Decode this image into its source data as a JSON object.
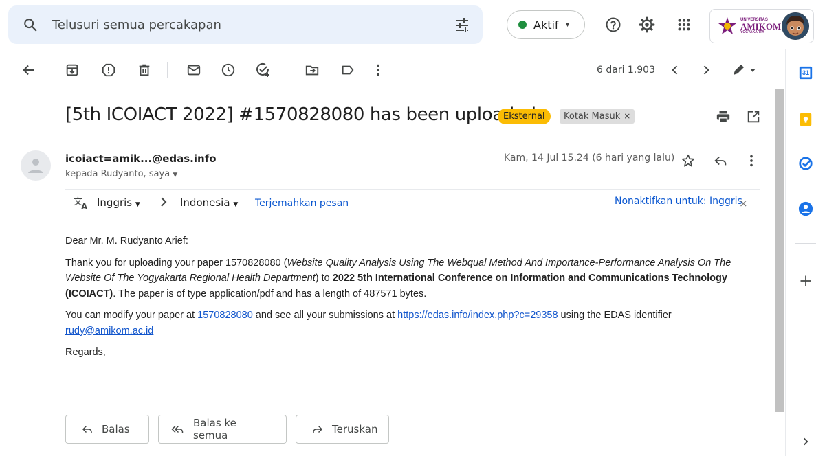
{
  "search": {
    "placeholder": "Telusuri semua percakapan"
  },
  "status": {
    "label": "Aktif",
    "color": "#1e8e3e"
  },
  "account": {
    "logo_line1": "UNIVERSITAS",
    "logo_line2": "AMIKOM",
    "logo_line3": "YOGYAKARTA"
  },
  "toolbar": {
    "icons": [
      "back-arrow-icon",
      "archive-icon",
      "report-spam-icon",
      "delete-icon",
      "mark-unread-icon",
      "snooze-icon",
      "add-task-icon",
      "move-to-icon",
      "label-icon",
      "more-vert-icon"
    ],
    "pager": "6 dari 1.903"
  },
  "message": {
    "subject": "[5th ICOIACT 2022] #1570828080 has been uploaded",
    "labels": {
      "external": "Eksternal",
      "inbox": "Kotak Masuk",
      "inbox_close": "×"
    },
    "sender": "icoiact=amik...@edas.info",
    "to": "kepada Rudyanto, saya",
    "date": "Kam, 14 Jul 15.24 (6 hari yang lalu)"
  },
  "translate": {
    "from": "Inggris",
    "to": "Indonesia",
    "action": "Terjemahkan pesan",
    "disable": "Nonaktifkan untuk: Inggris",
    "close": "×"
  },
  "body": {
    "greeting": "Dear Mr. M. Rudyanto Arief:",
    "p1_a": "Thank you for uploading your paper 1570828080 (",
    "p1_title": "Website Quality Analysis Using The Webqual Method And Importance-Performance Analysis On The Website Of The Yogyakarta Regional Health Department",
    "p1_b": ") to ",
    "p1_conf": "2022 5th International Conference on Information and Communications Technology (ICOIACT)",
    "p1_c": ". The paper is of type application/pdf and has a length of 487571 bytes.",
    "p2_a": "You can modify your paper at ",
    "p2_link1": "1570828080",
    "p2_b": " and see all your submissions at ",
    "p2_link2": "https://edas.info/index.php?c=29358",
    "p2_c": " using the EDAS identifier ",
    "p2_link3": "rudy@amikom.ac.id",
    "regards": "Regards,"
  },
  "actions": {
    "reply": "Balas",
    "reply_all": "Balas ke semua",
    "forward": "Teruskan"
  },
  "sidebar": {
    "calendar_day": "31",
    "icons": [
      "calendar-icon",
      "keep-icon",
      "tasks-icon",
      "contacts-icon",
      "add-icon",
      "expand-icon"
    ]
  }
}
